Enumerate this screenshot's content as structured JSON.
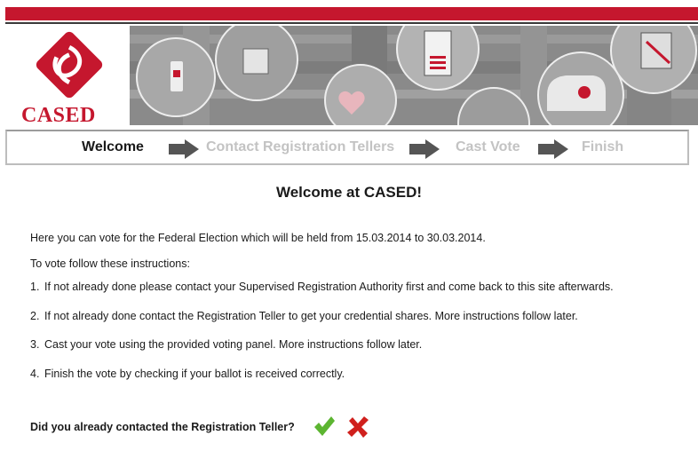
{
  "brand": {
    "name": "CASED",
    "color": "#c5172e"
  },
  "steps": [
    {
      "label": "Welcome",
      "state": "active"
    },
    {
      "label": "Contact Registration Tellers",
      "state": "inactive"
    },
    {
      "label": "Cast Vote",
      "state": "inactive"
    },
    {
      "label": "Finish",
      "state": "inactive"
    }
  ],
  "main": {
    "title": "Welcome at CASED!",
    "intro": "Here you can vote for the Federal Election which will be held from 15.03.2014 to 30.03.2014.",
    "instructions_label": "To vote follow these instructions:",
    "instructions": [
      {
        "num": "1.",
        "text": "If not already done please contact your Supervised Registration Authority first and come back to this site afterwards."
      },
      {
        "num": "2.",
        "text": "If not already done contact the Registration Teller to get your credential shares. More instructions follow later."
      },
      {
        "num": "3.",
        "text": "Cast your vote using the provided voting panel. More instructions follow later."
      },
      {
        "num": "4.",
        "text": "Finish the vote by checking if your ballot is received correctly."
      }
    ],
    "question": "Did you already contacted the Registration Teller?",
    "yes_icon": "checkmark-icon",
    "no_icon": "cross-icon"
  },
  "colors": {
    "accent": "#c5172e",
    "check": "#5cb531",
    "cross": "#d0201d",
    "inactive_step": "#c3c3c3"
  }
}
